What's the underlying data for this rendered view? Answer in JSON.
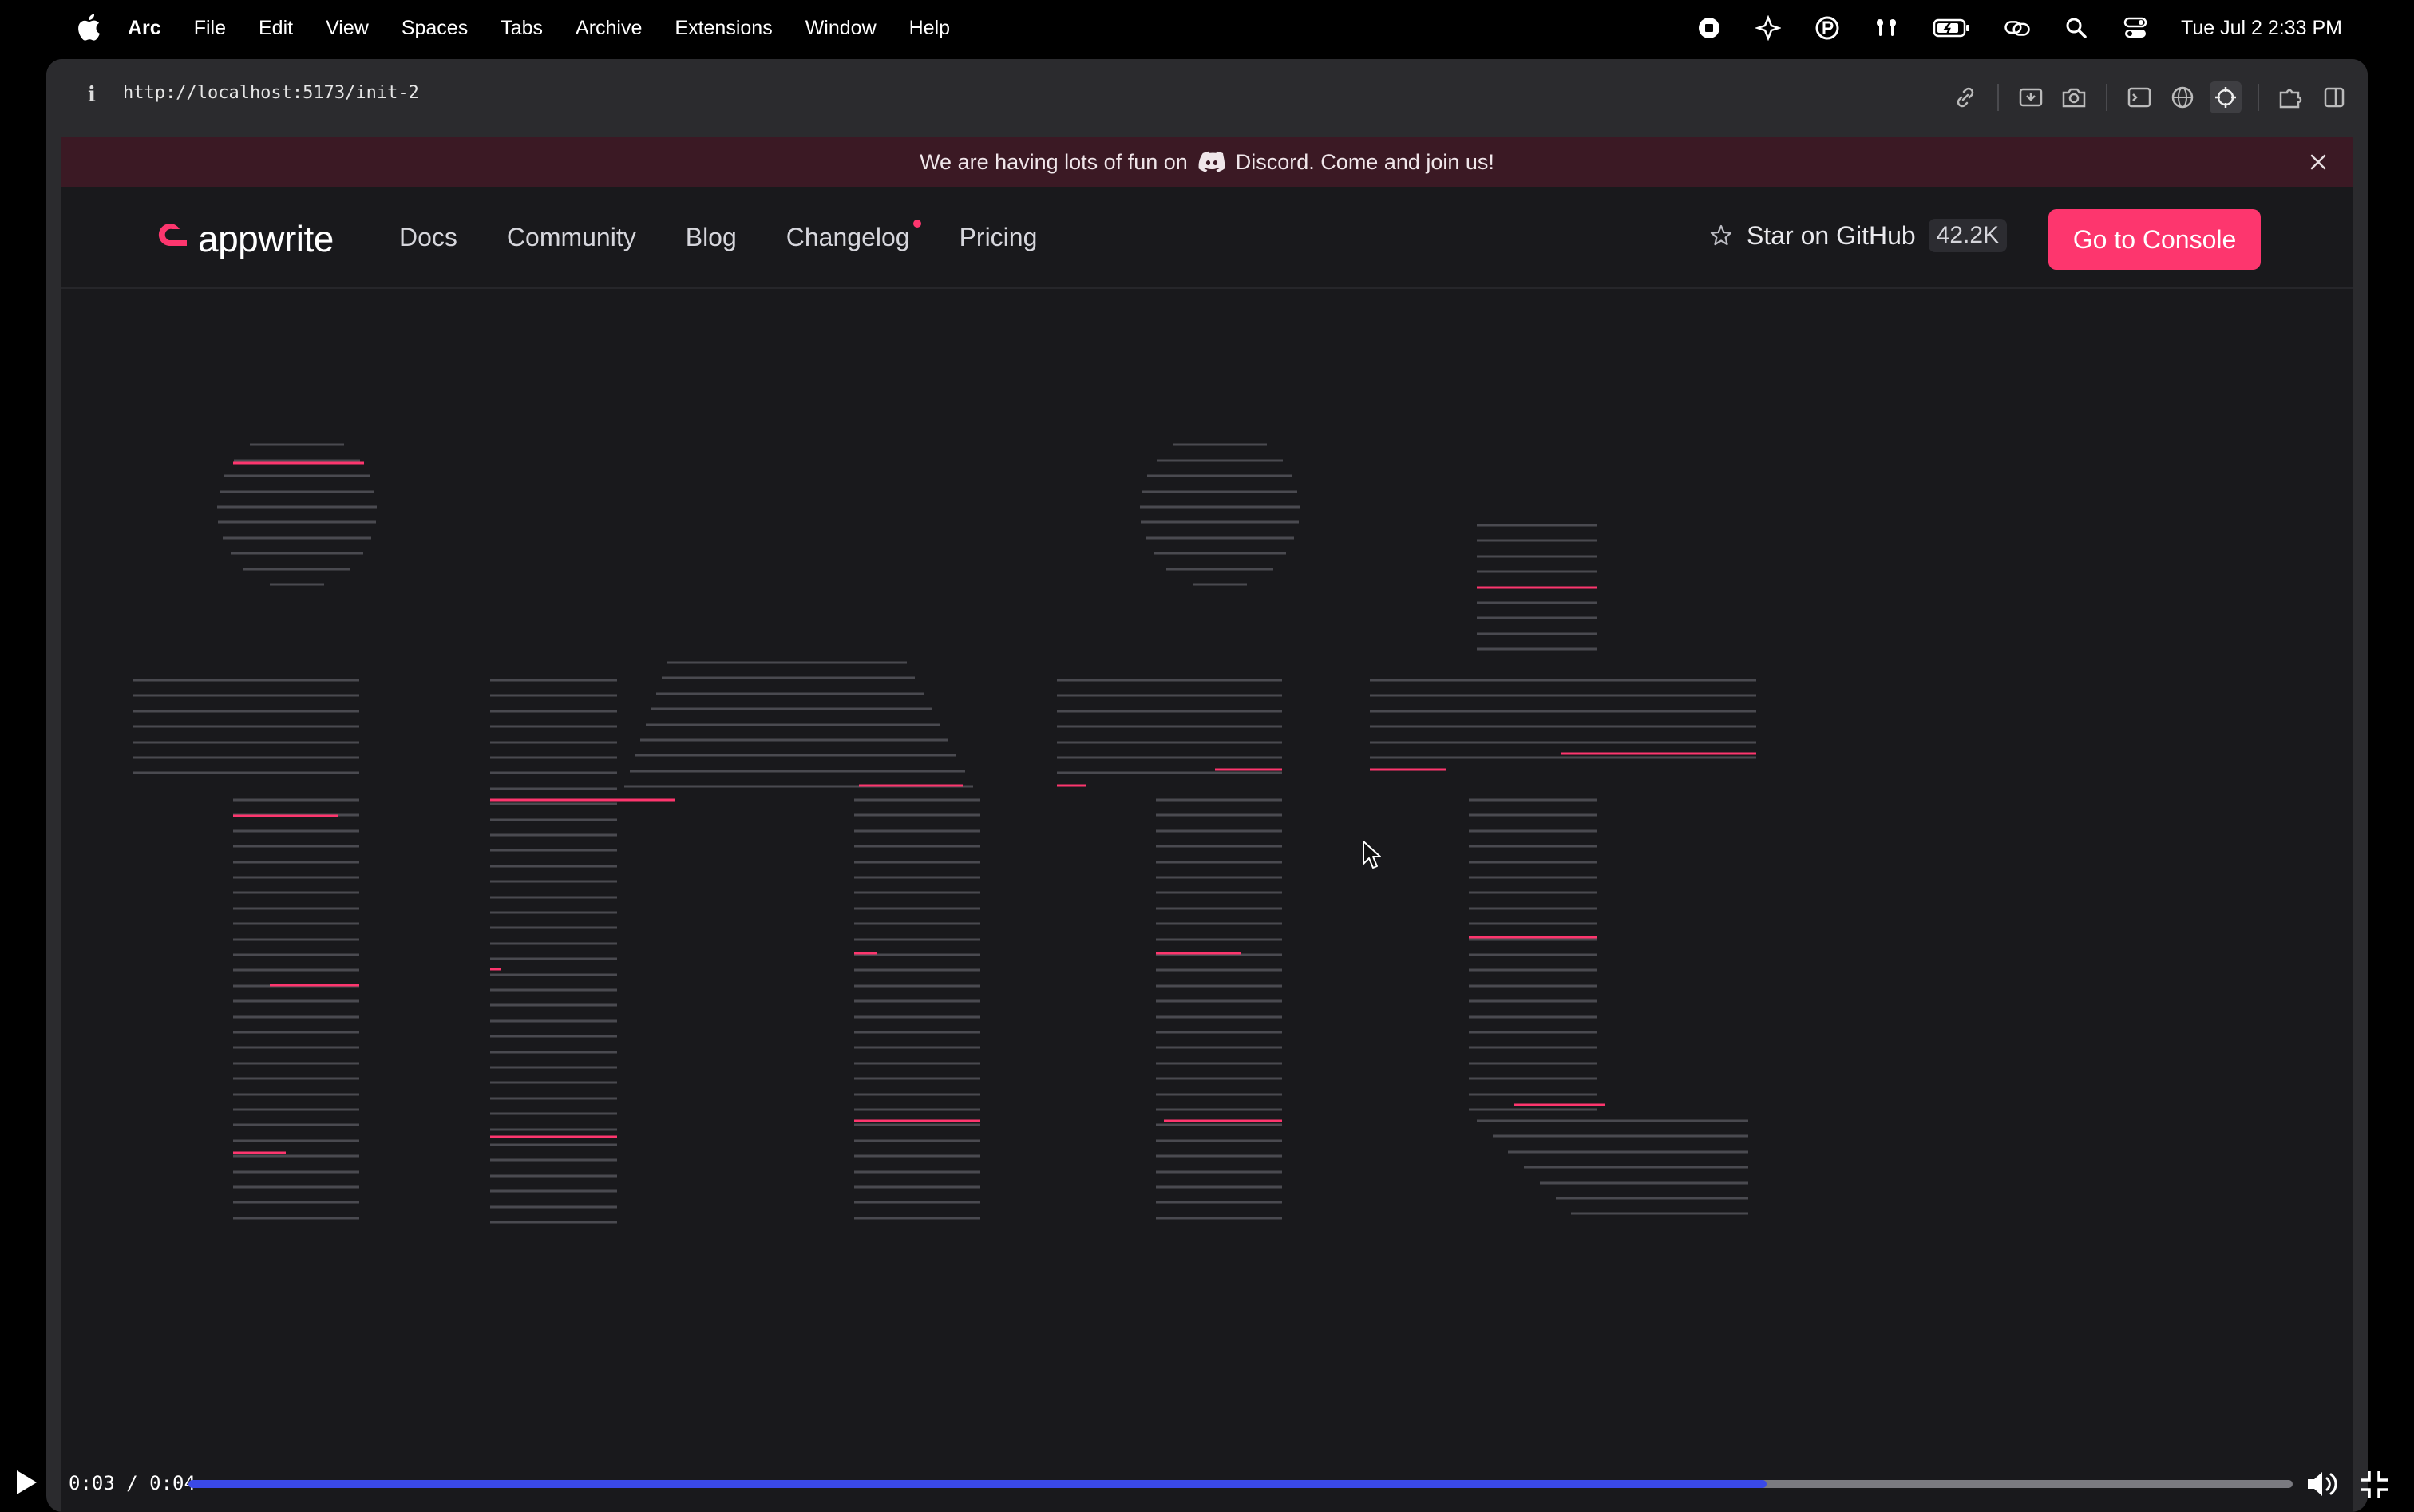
{
  "menubar": {
    "app_name": "Arc",
    "menus": [
      "File",
      "Edit",
      "View",
      "Spaces",
      "Tabs",
      "Archive",
      "Extensions",
      "Window",
      "Help"
    ],
    "clock": "Tue Jul 2  2:33 PM",
    "tray_icons": [
      "record-icon",
      "arc-boost-icon",
      "profile-icon",
      "airpods-icon",
      "battery-icon",
      "link-icon",
      "search-icon",
      "control-center-icon"
    ]
  },
  "browser": {
    "url": "http://localhost:5173/init-2",
    "toolbar_icons": [
      "copy-link-icon",
      "capture-icon",
      "screenshot-icon",
      "terminal-icon",
      "globe-icon",
      "target-icon",
      "extensions-icon",
      "split-view-icon"
    ]
  },
  "banner": {
    "text_before": "We are having lots of fun on",
    "text_after": "Discord. Come and join us!"
  },
  "nav": {
    "logo": "appwrite",
    "links": [
      "Docs",
      "Community",
      "Blog",
      "Changelog",
      "Pricing"
    ],
    "github_label": "Star on GitHub",
    "github_count": "42.2K",
    "console_button": "Go to Console"
  },
  "colors": {
    "accent": "#fd366e",
    "page_bg": "#19191c",
    "banner_bg": "#3b1924",
    "stripe": "#4a4a50",
    "progress": "#3a49e8"
  },
  "video": {
    "time": "0:03 / 0:04",
    "progress_fraction": 0.75
  }
}
